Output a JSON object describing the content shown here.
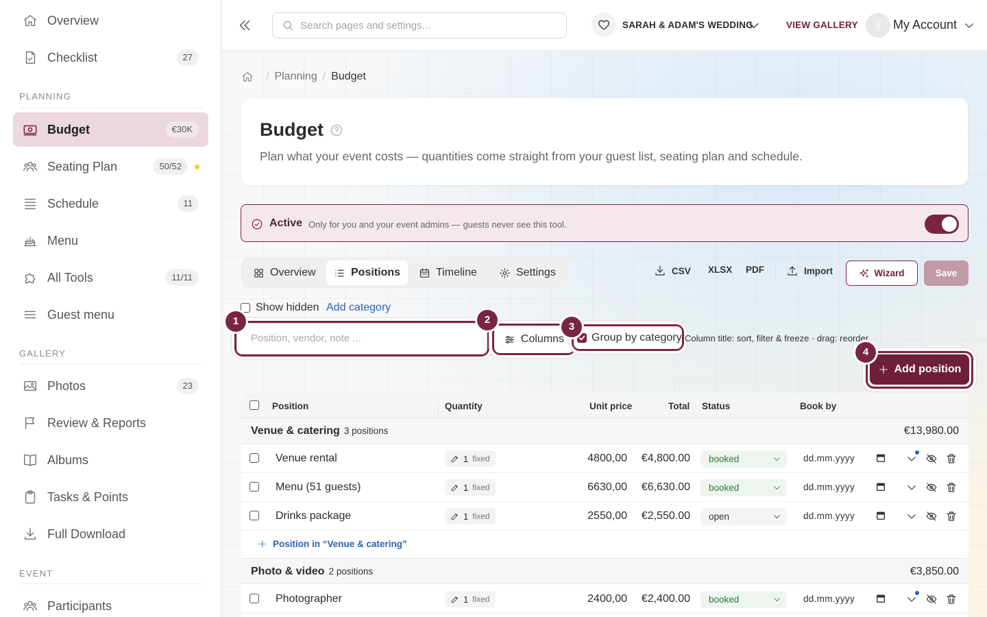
{
  "sidebar": {
    "items": [
      {
        "label": "Overview",
        "badge": "",
        "icon": "home-icon"
      },
      {
        "label": "Checklist",
        "badge": "27",
        "icon": "checklist-icon"
      },
      {
        "label": "Budget",
        "badge": "€30K",
        "icon": "money-icon",
        "active": true
      },
      {
        "label": "Seating Plan",
        "badge": "50/52",
        "icon": "people-icon"
      },
      {
        "label": "Schedule",
        "badge": "11",
        "icon": "list-icon"
      },
      {
        "label": "Menu",
        "badge": "",
        "icon": "cake-icon"
      },
      {
        "label": "All Tools",
        "badge": "11/11",
        "icon": "puzzle-icon"
      },
      {
        "label": "Guest menu",
        "badge": "",
        "icon": "menu-icon"
      },
      {
        "label": "Photos",
        "badge": "23",
        "icon": "image-icon"
      },
      {
        "label": "Review & Reports",
        "badge": "",
        "icon": "flag-icon"
      },
      {
        "label": "Albums",
        "badge": "",
        "icon": "book-icon"
      },
      {
        "label": "Tasks & Points",
        "badge": "",
        "icon": "clipboard-icon"
      },
      {
        "label": "Full Download",
        "badge": "",
        "icon": "download-icon"
      },
      {
        "label": "Participants",
        "badge": "",
        "icon": "people-icon"
      }
    ],
    "sections": {
      "planning": "PLANNING",
      "gallery": "GALLERY",
      "event": "EVENT"
    }
  },
  "topbar": {
    "search_placeholder": "Search pages and settings...",
    "event_name": "SARAH & ADAM'S WEDDING",
    "view_gallery": "VIEW GALLERY",
    "avatar_initial": "S",
    "account": "My Account"
  },
  "breadcrumb": {
    "parent": "Planning",
    "current": "Budget"
  },
  "header": {
    "title": "Budget",
    "description": "Plan what your event costs — quantities come straight from your guest list, seating plan and schedule."
  },
  "banner": {
    "label": "Active",
    "text": "Only for you and your event admins — guests never see this tool.",
    "enabled": true
  },
  "tabs": [
    {
      "label": "Overview",
      "icon": "grid-icon"
    },
    {
      "label": "Positions",
      "icon": "list-icon"
    },
    {
      "label": "Timeline",
      "icon": "calendar-icon"
    },
    {
      "label": "Settings",
      "icon": "gear-icon"
    }
  ],
  "toolbar": {
    "csv": "CSV",
    "xlsx": "XLSX",
    "pdf": "PDF",
    "import": "Import",
    "wizard": "Wizard",
    "save": "Save",
    "show_hidden": "Show hidden",
    "add_category": "Add category",
    "filter_placeholder": "Position, vendor, note ...",
    "columns": "Columns",
    "group_by": "Group by category",
    "hint": "Column title: sort, filter & freeze · drag: reorder",
    "add_position": "Add position"
  },
  "tour_markers": [
    "1",
    "2",
    "3",
    "4"
  ],
  "table": {
    "headers": {
      "position": "Position",
      "quantity": "Quantity",
      "unit_price": "Unit price",
      "total": "Total",
      "status": "Status",
      "book_by": "Book by"
    },
    "groups": [
      {
        "name": "Venue & catering",
        "count": "3 positions",
        "total": "€13,980.00",
        "rows": [
          {
            "name": "Venue rental",
            "qty": "1",
            "qty_type": "fixed",
            "unit_price": "4800,00",
            "total": "€4,800.00",
            "status": "booked",
            "book_by": "dd.mm.yyyy"
          },
          {
            "name": "Menu (51 guests)",
            "qty": "1",
            "qty_type": "fixed",
            "unit_price": "6630,00",
            "total": "€6,630.00",
            "status": "booked",
            "book_by": "dd.mm.yyyy"
          },
          {
            "name": "Drinks package",
            "qty": "1",
            "qty_type": "fixed",
            "unit_price": "2550,00",
            "total": "€2,550.00",
            "status": "open",
            "book_by": "dd.mm.yyyy"
          }
        ],
        "add_label": "Position in “Venue & catering”"
      },
      {
        "name": "Photo & video",
        "count": "2 positions",
        "total": "€3,850.00",
        "rows": [
          {
            "name": "Photographer",
            "qty": "1",
            "qty_type": "fixed",
            "unit_price": "2400,00",
            "total": "€2,400.00",
            "status": "booked",
            "book_by": "dd.mm.yyyy"
          }
        ]
      }
    ]
  },
  "colors": {
    "accent": "#6e1f3a",
    "link": "#2a62b4",
    "booked": "#2e7a3b"
  }
}
